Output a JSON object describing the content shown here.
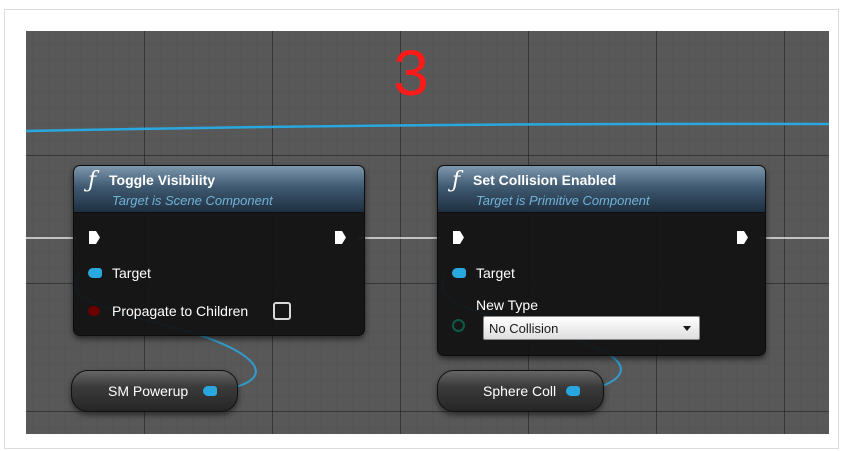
{
  "step_number": "3",
  "colors": {
    "graph_background": "#585858",
    "wire_blue": "#29a8e0",
    "exec_wire": "#e6e6e6",
    "step_number_red": "#ff1a1a",
    "node_subtitle": "#6fb3d6"
  },
  "nodes": [
    {
      "icon": "function-icon",
      "title": "Toggle Visibility",
      "subtitle": "Target is Scene Component",
      "pins": [
        {
          "type": "exec-in",
          "label": ""
        },
        {
          "type": "exec-out",
          "label": ""
        },
        {
          "type": "object",
          "label": "Target"
        },
        {
          "type": "bool",
          "label": "Propagate to Children",
          "checked": false
        }
      ]
    },
    {
      "icon": "function-icon",
      "title": "Set Collision Enabled",
      "subtitle": "Target is Primitive Component",
      "pins": [
        {
          "type": "exec-in",
          "label": ""
        },
        {
          "type": "exec-out",
          "label": ""
        },
        {
          "type": "object",
          "label": "Target"
        },
        {
          "type": "enum",
          "label": "New Type",
          "value": "No Collision"
        }
      ]
    }
  ],
  "variables": [
    {
      "label": "SM Powerup"
    },
    {
      "label": "Sphere Coll"
    }
  ]
}
